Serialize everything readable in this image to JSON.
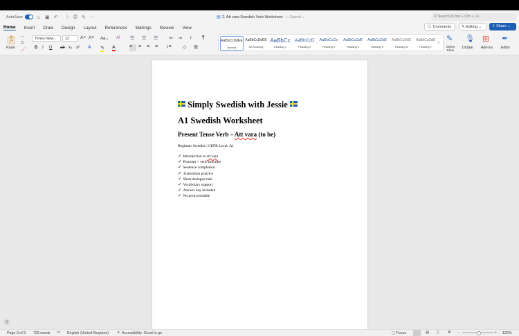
{
  "titlebar": {
    "autosave": "AutoSave",
    "doc_title": "2. Att vara Swedish Verb Worksheet",
    "saved": "— Saved ⌄",
    "search_placeholder": "Search (Cmd + Ctrl + U)"
  },
  "tabs": [
    "Home",
    "Insert",
    "Draw",
    "Design",
    "Layout",
    "References",
    "Mailings",
    "Review",
    "View"
  ],
  "actions": {
    "comments": "Comments",
    "editing": "Editing",
    "share": "Share"
  },
  "ribbon": {
    "paste": "Paste",
    "font": "Times New...",
    "size": "12",
    "styles_pane": "Styles Pane",
    "dictate": "Dictate",
    "addins": "Add-ins",
    "editor": "Editor"
  },
  "styles": [
    {
      "sample": "AaBbCcDdEE",
      "name": "Normal"
    },
    {
      "sample": "AaBbCcDdEE",
      "name": "No Spacing"
    },
    {
      "sample": "AaBbCc",
      "name": "Heading 1"
    },
    {
      "sample": "AaBbCcD",
      "name": "Heading 2"
    },
    {
      "sample": "AaBbCcDc",
      "name": "Heading 3"
    },
    {
      "sample": "AaBbCcDdE",
      "name": "Heading 4"
    },
    {
      "sample": "AaBbCcDdE",
      "name": "Heading 5"
    },
    {
      "sample": "AaBbCcDdE",
      "name": "Heading 6"
    },
    {
      "sample": "AaBbCcDdE",
      "name": "Heading 7"
    }
  ],
  "document": {
    "title": "Simply Swedish with Jessie",
    "heading1": "A1 Swedish Worksheet",
    "heading2_pre": "Present Tense Verb – ",
    "heading2_em": "Att vara",
    "heading2_post": " (to be)",
    "subtitle": "Beginner Swedish | CEFR Level: A1",
    "list": [
      "Introduction to ",
      "Pronoun + verb structure",
      "Sentence completion",
      "Translation practice",
      "Short dialogue task",
      "Vocabulary support",
      "Answer key included",
      "No prep printable"
    ],
    "list0_em": "att vara",
    "check": "✓"
  },
  "status": {
    "page": "Page 3 of 9",
    "words": "793 words",
    "language": "English (United Kingdom)",
    "accessibility": "Accessibility: Good to go",
    "focus": "Focus",
    "zoom": "120%",
    "zoom_level": 120
  },
  "colors": {
    "accent": "#1a5fb4"
  }
}
